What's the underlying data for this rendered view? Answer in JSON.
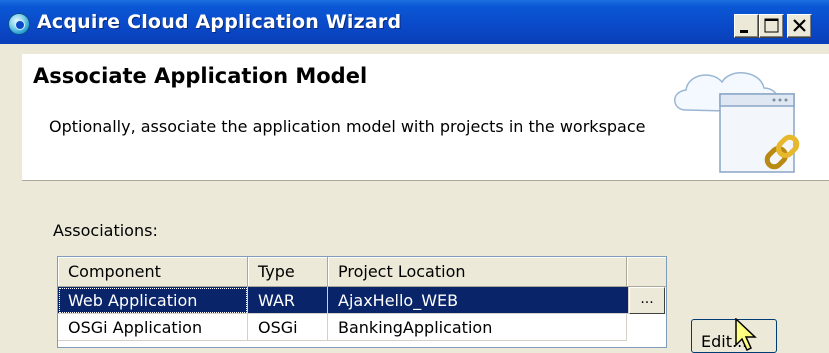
{
  "window": {
    "title": "Acquire Cloud Application Wizard",
    "icon": "cloud-app-icon",
    "controls": {
      "minimize": "minimize-icon",
      "maximize": "maximize-icon",
      "close": "close-icon"
    }
  },
  "header": {
    "title": "Associate Application Model",
    "description": "Optionally, associate the application model with projects in the workspace",
    "banner_icon": "cloud-link-icon"
  },
  "associations": {
    "label": "Associations:",
    "columns": [
      "Component",
      "Type",
      "Project Location"
    ],
    "rows": [
      {
        "component": "Web Application",
        "type": "WAR",
        "location": "AjaxHello_WEB",
        "selected": true
      },
      {
        "component": "OSGi Application",
        "type": "OSGi",
        "location": "BankingApplication",
        "selected": false
      }
    ],
    "browse_label": "..."
  },
  "buttons": {
    "edit": "Edit..."
  },
  "colors": {
    "titlebar": "#0a49c8",
    "selection": "#0a246a",
    "dialog": "#ece9d8"
  }
}
